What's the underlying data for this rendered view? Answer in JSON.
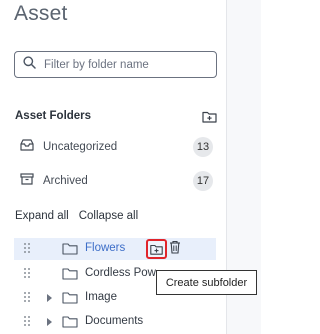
{
  "panel": {
    "title": "Asset",
    "search": {
      "placeholder": "Filter by folder name",
      "value": ""
    },
    "section_title": "Asset Folders",
    "system_folders": [
      {
        "label": "Uncategorized",
        "count": "13",
        "icon": "inbox-icon"
      },
      {
        "label": "Archived",
        "count": "17",
        "icon": "archive-icon"
      }
    ],
    "actions": {
      "expand_all": "Expand all",
      "collapse_all": "Collapse all"
    },
    "tree": [
      {
        "label": "Flowers",
        "selected": true,
        "has_children": false
      },
      {
        "label": "Cordless Pow",
        "selected": false,
        "has_children": false
      },
      {
        "label": "Image",
        "selected": false,
        "has_children": true
      },
      {
        "label": "Documents",
        "selected": false,
        "has_children": true
      }
    ],
    "tooltip": "Create subfolder"
  },
  "colors": {
    "accent": "#3d6ec8",
    "selected_row": "#e8effb",
    "highlight_border": "#e0242b",
    "badge_bg": "#e6e8eb"
  }
}
